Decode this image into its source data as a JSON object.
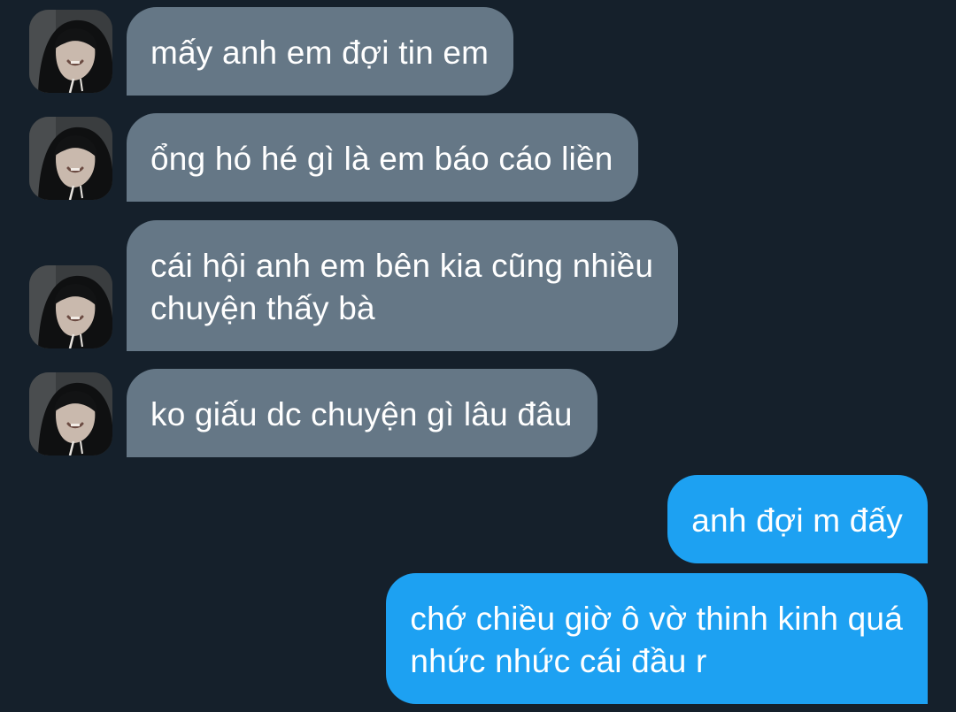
{
  "conversation": {
    "messages": [
      {
        "direction": "incoming",
        "lines": [
          "mấy anh em đợi tin em"
        ]
      },
      {
        "direction": "incoming",
        "lines": [
          "ổng hó hé gì là em báo cáo liền"
        ]
      },
      {
        "direction": "incoming",
        "lines": [
          "cái hội anh em bên kia cũng nhiều",
          "chuyện thấy bà"
        ]
      },
      {
        "direction": "incoming",
        "lines": [
          "ko giấu dc chuyện gì lâu đâu"
        ]
      },
      {
        "direction": "outgoing",
        "lines": [
          "anh đợi m đấy"
        ]
      },
      {
        "direction": "outgoing",
        "lines": [
          "chớ chiều giờ ô vờ thinh kinh quá",
          "nhức nhức cái đầu r"
        ]
      }
    ]
  },
  "colors": {
    "background": "#15202b",
    "incoming_bubble": "#657786",
    "outgoing_bubble": "#1da1f2",
    "text": "#ffffff"
  },
  "icons": {
    "avatar": "sender-avatar-photo"
  }
}
